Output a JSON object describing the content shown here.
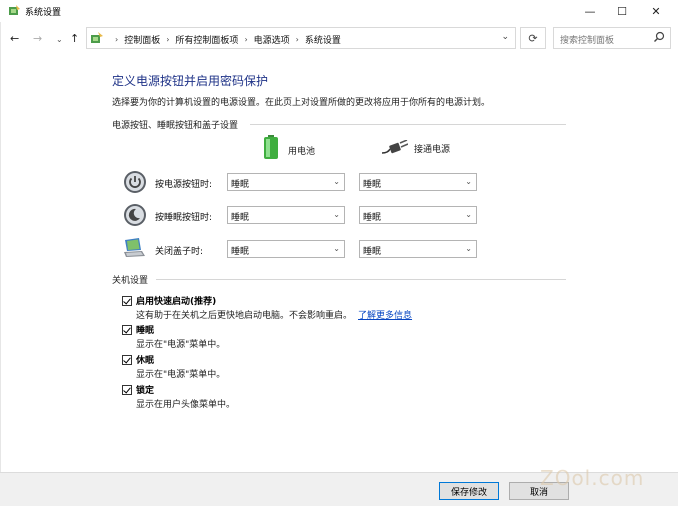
{
  "window": {
    "title": "系统设置",
    "controls": {
      "minimize": "—",
      "maximize": "☐",
      "close": "✕"
    }
  },
  "nav": {
    "back": "←",
    "forward": "→",
    "recent": "⌄",
    "up": "↑",
    "breadcrumbs": [
      "控制面板",
      "所有控制面板项",
      "电源选项",
      "系统设置"
    ],
    "separator": "›",
    "dropdown": "⌄",
    "refresh": "⟳",
    "search_placeholder": "搜索控制面板"
  },
  "main": {
    "title": "定义电源按钮并启用密码保护",
    "description": "选择要为你的计算机设置的电源设置。在此页上对设置所做的更改将应用于你所有的电源计划。",
    "power_section": {
      "heading": "电源按钮、睡眠按钮和盖子设置",
      "columns": [
        "用电池",
        "接通电源"
      ],
      "rows": [
        {
          "label": "按电源按钮时:",
          "icon": "power-icon",
          "battery": "睡眠",
          "plugged": "睡眠"
        },
        {
          "label": "按睡眠按钮时:",
          "icon": "sleep-icon",
          "battery": "睡眠",
          "plugged": "睡眠"
        },
        {
          "label": "关闭盖子时:",
          "icon": "laptop-lid-icon",
          "battery": "睡眠",
          "plugged": "睡眠"
        }
      ]
    },
    "shutdown_section": {
      "heading": "关机设置",
      "items": [
        {
          "label": "启用快速启动(推荐)",
          "checked": true,
          "desc": "这有助于在关机之后更快地启动电脑。不会影响重启。",
          "link": "了解更多信息"
        },
        {
          "label": "睡眠",
          "checked": true,
          "desc": "显示在\"电源\"菜单中。"
        },
        {
          "label": "休眠",
          "checked": true,
          "desc": "显示在\"电源\"菜单中。"
        },
        {
          "label": "锁定",
          "checked": true,
          "desc": "显示在用户头像菜单中。"
        }
      ]
    }
  },
  "footer": {
    "save": "保存修改",
    "cancel": "取消"
  },
  "watermark": "ZOol.com",
  "colors": {
    "title_blue": "#1e3287",
    "link_blue": "#0645c2",
    "primary_border": "#0078d7"
  }
}
